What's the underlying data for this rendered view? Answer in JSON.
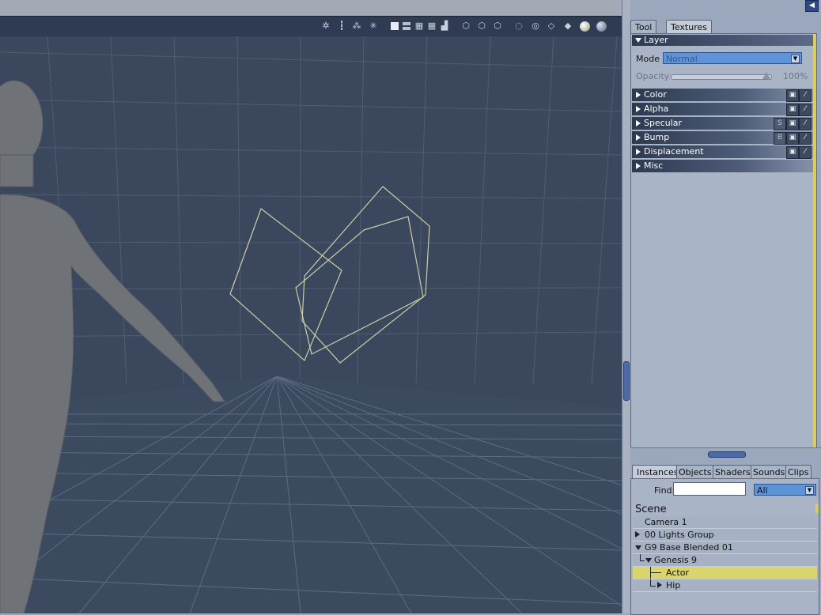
{
  "right_panel": {
    "top_tabs": [
      {
        "label": "Tool"
      },
      {
        "label": "Textures"
      }
    ],
    "layer": {
      "header": "Layer",
      "mode_label": "Mode",
      "mode_value": "Normal",
      "opacity_label": "Opacity",
      "opacity_value": "100%",
      "opacity_fraction": 1.0
    },
    "sections": [
      {
        "label": "Color",
        "badge": ""
      },
      {
        "label": "Alpha",
        "badge": ""
      },
      {
        "label": "Specular",
        "badge": "S"
      },
      {
        "label": "Bump",
        "badge": "B"
      },
      {
        "label": "Displacement",
        "badge": ""
      },
      {
        "label": "Misc",
        "badge": ""
      }
    ],
    "bottom_tabs": [
      {
        "label": "Instances"
      },
      {
        "label": "Objects"
      },
      {
        "label": "Shaders"
      },
      {
        "label": "Sounds"
      },
      {
        "label": "Clips"
      }
    ],
    "find_label": "Find:",
    "find_value": "",
    "filter_value": "All",
    "tree": {
      "root": "Scene",
      "items": [
        {
          "label": "Camera 1"
        },
        {
          "label": "00 Lights Group"
        },
        {
          "label": "G9 Base Blended 01"
        },
        {
          "label": "Genesis 9"
        },
        {
          "label": "Actor"
        },
        {
          "label": "Hip"
        }
      ]
    }
  },
  "icons": {
    "collapse_panel": "arrow-left-icon",
    "image_badge": "image-icon",
    "wand_badge": "magic-wand-icon"
  },
  "colors": {
    "viewport_bg": "#3a475c",
    "selection": "#d9d56a",
    "accent": "#5f93d8"
  }
}
